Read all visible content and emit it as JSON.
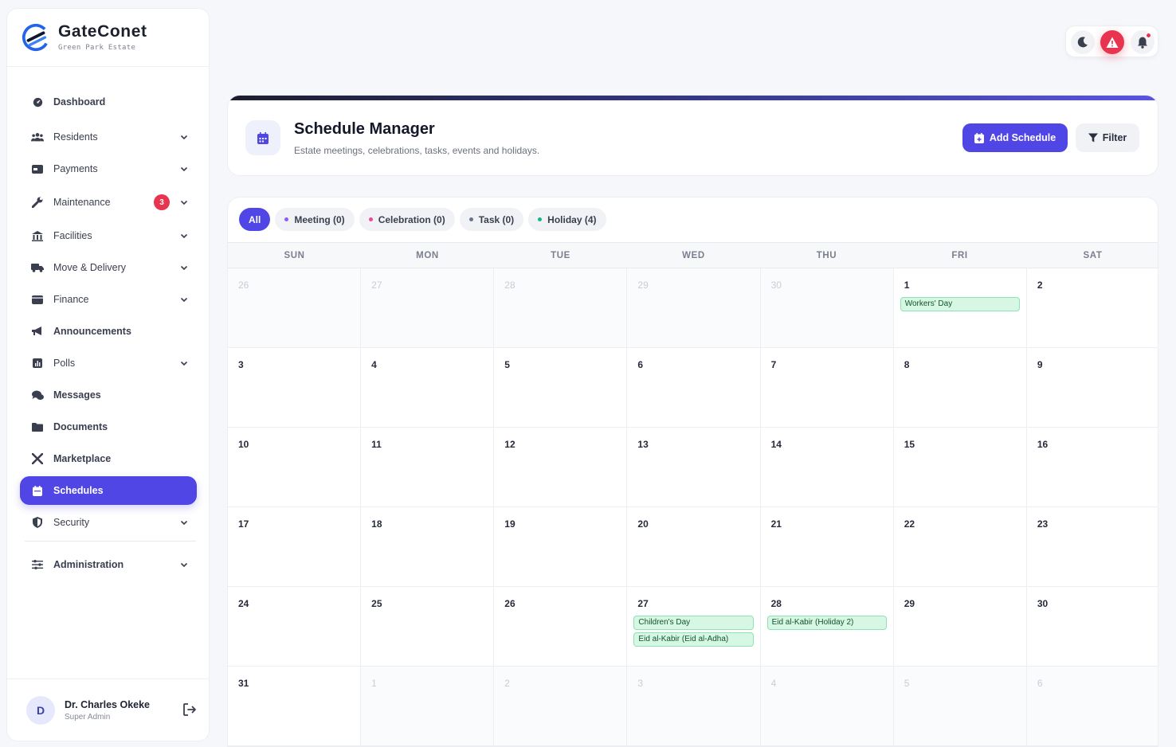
{
  "brand": {
    "name": "GateConet",
    "subtitle": "Green Park Estate"
  },
  "sidebar": {
    "items": [
      {
        "label": "Dashboard",
        "icon": "gauge-icon"
      },
      {
        "label": "Residents",
        "icon": "users-icon"
      },
      {
        "label": "Payments",
        "icon": "card-icon"
      },
      {
        "label": "Maintenance",
        "icon": "wrench-icon",
        "badge": "3"
      },
      {
        "label": "Facilities",
        "icon": "building-icon"
      },
      {
        "label": "Move & Delivery",
        "icon": "truck-icon"
      },
      {
        "label": "Finance",
        "icon": "wallet-icon"
      },
      {
        "label": "Announcements",
        "icon": "megaphone-icon"
      },
      {
        "label": "Polls",
        "icon": "chart-icon"
      },
      {
        "label": "Messages",
        "icon": "chat-icon"
      },
      {
        "label": "Documents",
        "icon": "folder-icon"
      },
      {
        "label": "Marketplace",
        "icon": "tools-icon"
      },
      {
        "label": "Schedules",
        "icon": "calendar-icon",
        "active": true
      },
      {
        "label": "Security",
        "icon": "shield-icon"
      },
      {
        "label": "Administration",
        "icon": "sliders-icon"
      }
    ]
  },
  "user": {
    "initial": "D",
    "name": "Dr. Charles Okeke",
    "role": "Super Admin"
  },
  "header": {
    "title": "Schedule Manager",
    "subtitle": "Estate meetings, celebrations, tasks, events and holidays.",
    "add_label": "Add Schedule",
    "filter_label": "Filter"
  },
  "filters": [
    {
      "label": "All",
      "active": true
    },
    {
      "label": "Meeting (0)",
      "color": "#8b5cf6"
    },
    {
      "label": "Celebration (0)",
      "color": "#ec4899"
    },
    {
      "label": "Task (0)",
      "color": "#64748b"
    },
    {
      "label": "Holiday (4)",
      "color": "#10b981"
    }
  ],
  "calendar": {
    "weekdays": [
      "SUN",
      "MON",
      "TUE",
      "WED",
      "THU",
      "FRI",
      "SAT"
    ],
    "weeks": [
      [
        {
          "d": "26",
          "m": true
        },
        {
          "d": "27",
          "m": true
        },
        {
          "d": "28",
          "m": true
        },
        {
          "d": "29",
          "m": true
        },
        {
          "d": "30",
          "m": true
        },
        {
          "d": "1",
          "events": [
            "Workers' Day"
          ]
        },
        {
          "d": "2"
        }
      ],
      [
        {
          "d": "3"
        },
        {
          "d": "4"
        },
        {
          "d": "5"
        },
        {
          "d": "6"
        },
        {
          "d": "7"
        },
        {
          "d": "8"
        },
        {
          "d": "9"
        }
      ],
      [
        {
          "d": "10"
        },
        {
          "d": "11"
        },
        {
          "d": "12"
        },
        {
          "d": "13"
        },
        {
          "d": "14"
        },
        {
          "d": "15"
        },
        {
          "d": "16"
        }
      ],
      [
        {
          "d": "17"
        },
        {
          "d": "18"
        },
        {
          "d": "19"
        },
        {
          "d": "20"
        },
        {
          "d": "21"
        },
        {
          "d": "22"
        },
        {
          "d": "23"
        }
      ],
      [
        {
          "d": "24"
        },
        {
          "d": "25"
        },
        {
          "d": "26"
        },
        {
          "d": "27",
          "events": [
            "Children's Day",
            "Eid al-Kabir (Eid al-Adha)"
          ]
        },
        {
          "d": "28",
          "events": [
            "Eid al-Kabir (Holiday 2)"
          ]
        },
        {
          "d": "29"
        },
        {
          "d": "30"
        }
      ],
      [
        {
          "d": "31"
        },
        {
          "d": "1",
          "m": true
        },
        {
          "d": "2",
          "m": true
        },
        {
          "d": "3",
          "m": true
        },
        {
          "d": "4",
          "m": true
        },
        {
          "d": "5",
          "m": true
        },
        {
          "d": "6",
          "m": true
        }
      ]
    ]
  },
  "colors": {
    "accent": "#4f46e5",
    "alert": "#e8344e",
    "holiday_bg": "#d5f7e3"
  }
}
